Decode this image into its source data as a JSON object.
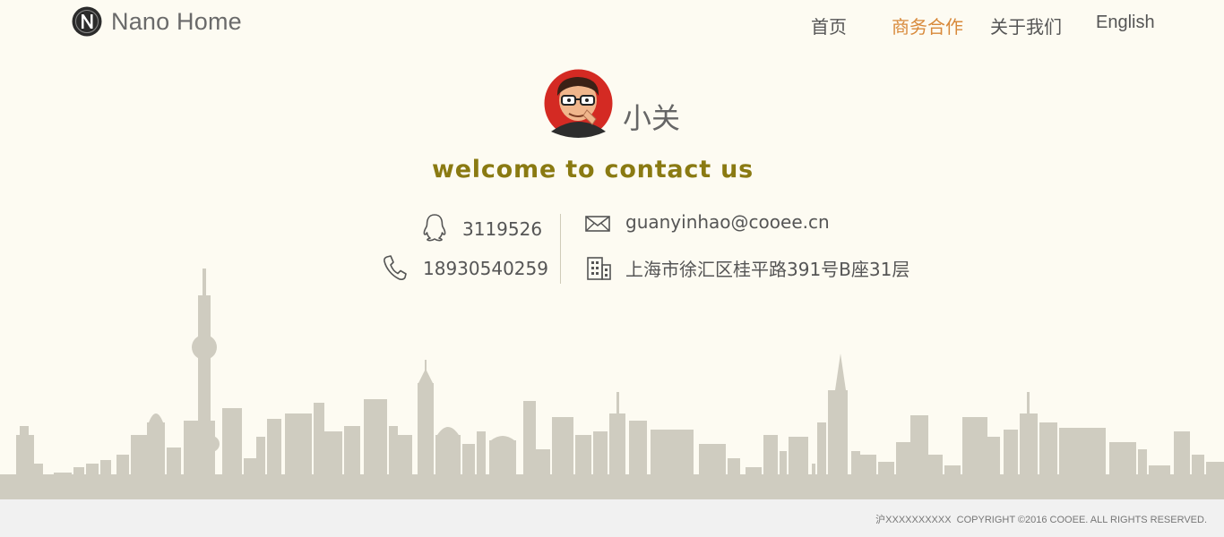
{
  "header": {
    "brand": "Nano Home",
    "logo_icon": "n-logo-icon",
    "nav": [
      {
        "label": "首页",
        "active": false
      },
      {
        "label": "商务合作",
        "active": true
      },
      {
        "label": "关于我们",
        "active": false
      },
      {
        "label": "English",
        "active": false
      }
    ]
  },
  "profile": {
    "name": "小关",
    "avatar_icon": "cartoon-avatar-icon"
  },
  "welcome": "welcome to contact us",
  "contacts": {
    "qq": {
      "icon": "qq-penguin-icon",
      "value": "3119526"
    },
    "phone": {
      "icon": "phone-icon",
      "value": "18930540259"
    },
    "email": {
      "icon": "envelope-icon",
      "value": "guanyinhao@cooee.cn"
    },
    "address": {
      "icon": "building-icon",
      "value": "上海市徐汇区桂平路391号B座31层"
    }
  },
  "footer": {
    "icp": "沪XXXXXXXXXX",
    "copyright": "COPYRIGHT ©2016 COOEE. ALL RIGHTS RESERVED."
  },
  "colors": {
    "background": "#fdfbf2",
    "accent_nav": "#d8893a",
    "welcome": "#8a7a12",
    "skyline": "#cfccc0",
    "footer_bg": "#f1f1f1"
  }
}
